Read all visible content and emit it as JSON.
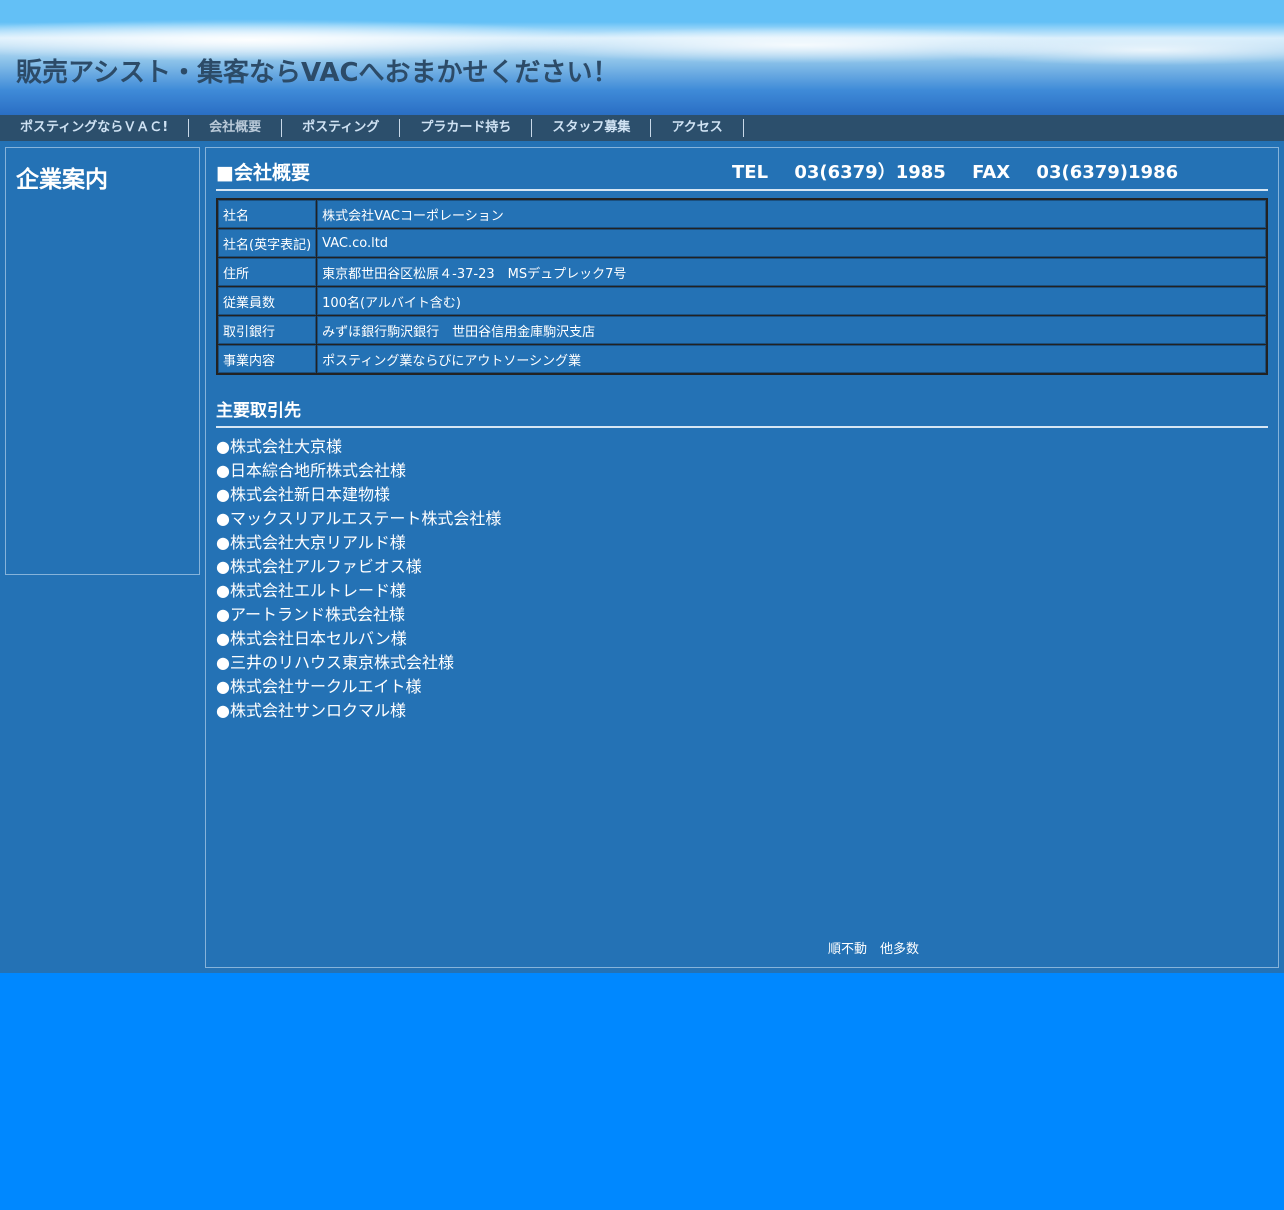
{
  "header": {
    "title": "販売アシスト・集客ならVACへおまかせください！"
  },
  "nav": {
    "items": [
      {
        "label": "ポスティングならＶＡＣ!"
      },
      {
        "label": "会社概要"
      },
      {
        "label": "ポスティング"
      },
      {
        "label": "プラカード持ち"
      },
      {
        "label": "スタッフ募集"
      },
      {
        "label": "アクセス"
      }
    ],
    "active": "会社概要"
  },
  "sidebar": {
    "title": "企業案内"
  },
  "main": {
    "section_title": "■会社概要",
    "contact": {
      "tel_label": "TEL",
      "tel": "03(6379）1985",
      "fax_label": "FAX",
      "fax": "03(6379)1986"
    },
    "table": [
      {
        "label": "社名",
        "value": "株式会社VACコーポレーション"
      },
      {
        "label": "社名(英字表記)",
        "value": "VAC.co.ltd"
      },
      {
        "label": "住所",
        "value": "東京都世田谷区松原４-37-23　MSデュプレック7号"
      },
      {
        "label": "従業員数",
        "value": "100名(アルバイト含む)"
      },
      {
        "label": "取引銀行",
        "value": "みずほ銀行駒沢銀行　世田谷信用金庫駒沢支店"
      },
      {
        "label": "事業内容",
        "value": "ポスティング業ならびにアウトソーシング業"
      }
    ],
    "clients_title": "主要取引先",
    "clients": [
      "●株式会社大京様",
      "●日本綜合地所株式会社様",
      "●株式会社新日本建物様",
      "●マックスリアルエステート株式会社様",
      "●株式会社大京リアルド様",
      "●株式会社アルファビオス様",
      "●株式会社エルトレード様",
      "●アートランド株式会社様",
      "●株式会社日本セルバン様",
      "●三井のリハウス東京株式会社様",
      "●株式会社サークルエイト様",
      "●株式会社サンロクマル様"
    ],
    "footer_note": "順不動　他多数"
  },
  "colors": {
    "page_bg": "#0088ff",
    "content_bg": "#2472b5",
    "nav_bg": "#2c4f6c",
    "title_color": "#2c4b68"
  }
}
